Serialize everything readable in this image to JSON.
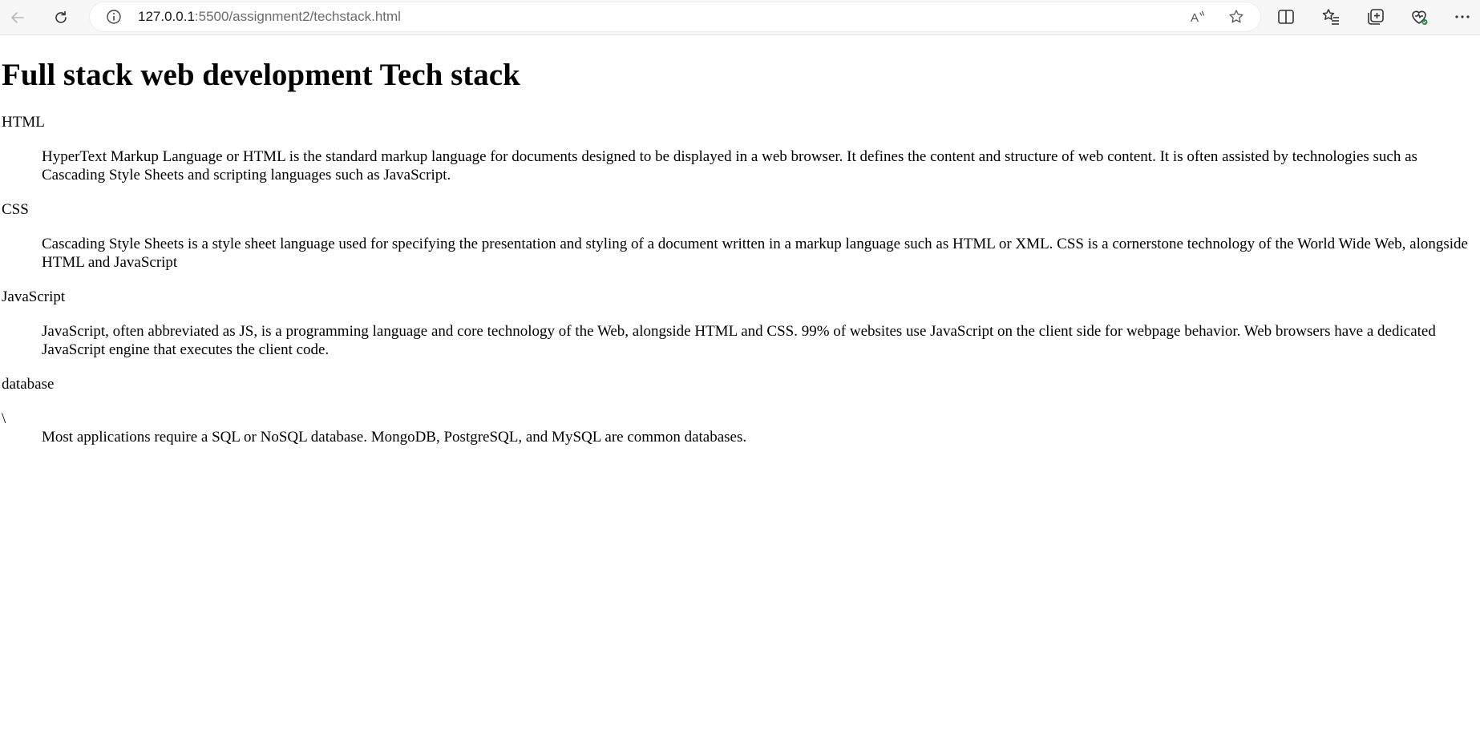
{
  "browser": {
    "url_host": "127.0.0.1",
    "url_path": ":5500/assignment2/techstack.html",
    "icons": {
      "back": "arrow-left-icon",
      "refresh": "refresh-icon",
      "info": "info-icon",
      "read_aloud": "read-aloud-icon",
      "favorite": "star-icon",
      "split_screen": "split-screen-icon",
      "favorites": "favorites-list-icon",
      "collections": "collections-icon",
      "health": "browser-essentials-icon",
      "more": "more-icon"
    }
  },
  "page": {
    "title": "Full stack web development Tech stack",
    "terms": [
      {
        "term": "HTML",
        "definition": "HyperText Markup Language or HTML is the standard markup language for documents designed to be displayed in a web browser. It defines the content and structure of web content. It is often assisted by technologies such as Cascading Style Sheets and scripting languages such as JavaScript."
      },
      {
        "term": "CSS",
        "definition": "Cascading Style Sheets is a style sheet language used for specifying the presentation and styling of a document written in a markup language such as HTML or XML. CSS is a cornerstone technology of the World Wide Web, alongside HTML and JavaScript"
      },
      {
        "term": "JavaScript",
        "definition": "JavaScript, often abbreviated as JS, is a programming language and core technology of the Web, alongside HTML and CSS. 99% of websites use JavaScript on the client side for webpage behavior. Web browsers have a dedicated JavaScript engine that executes the client code."
      },
      {
        "term": "database",
        "stray": "\\",
        "definition": "Most applications require a SQL or NoSQL database. MongoDB, PostgreSQL, and MySQL are common databases."
      }
    ]
  }
}
